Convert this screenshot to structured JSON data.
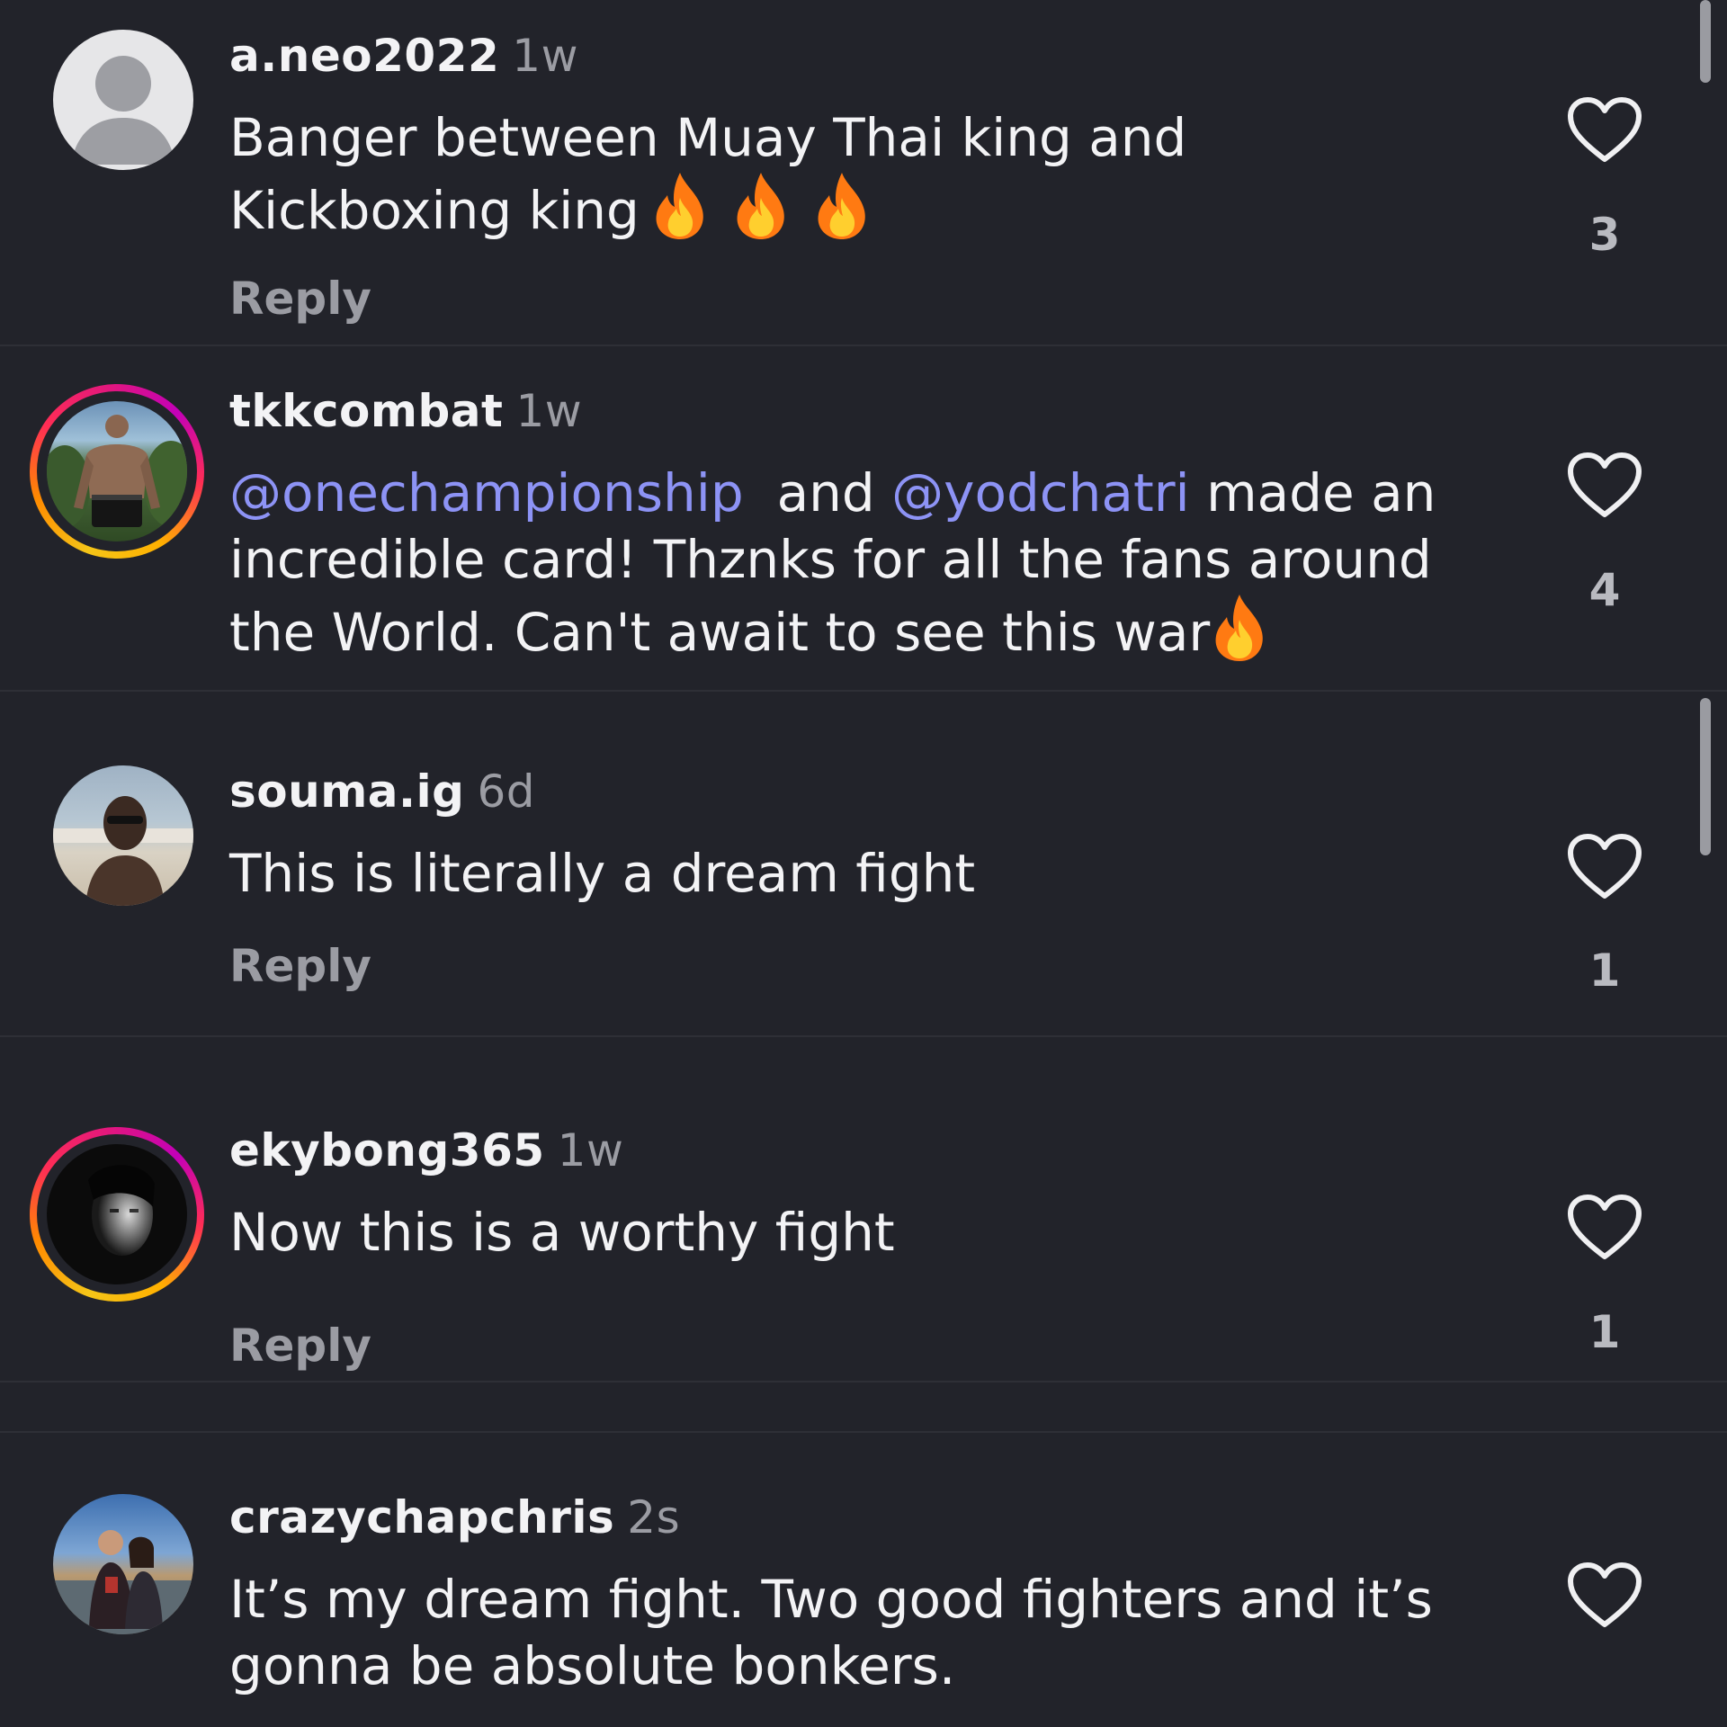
{
  "comments": [
    {
      "username": "a.neo2022",
      "time": "1w",
      "text": "Banger between Muay Thai king and Kickboxing king",
      "reply_label": "Reply",
      "likes": "3",
      "avatar": "default-user-avatar"
    },
    {
      "username": "tkkcombat",
      "time": "1w",
      "mention1": "@onechampionship",
      "text_mid": "and",
      "mention2": "@yodchatri",
      "text_rest": "made an incredible card! Thznks for all the fans around the World. Can't await to see this war",
      "likes": "4",
      "avatar": "photo-avatar-with-story-ring"
    },
    {
      "username": "souma.ig",
      "time": "6d",
      "text": "This is literally a dream fight",
      "reply_label": "Reply",
      "likes": "1",
      "avatar": "photo-avatar"
    },
    {
      "username": "ekybong365",
      "time": "1w",
      "text": "Now this is a worthy fight",
      "reply_label": "Reply",
      "likes": "1",
      "avatar": "photo-avatar-with-story-ring"
    },
    {
      "username": "crazychapchris",
      "time": "2s",
      "text": "It’s my dream fight. Two good fighters and it’s gonna be absolute bonkers.",
      "avatar": "photo-avatar"
    }
  ],
  "icons": {
    "like": "heart-outline-icon",
    "emoji": "fire-emoji"
  },
  "colors": {
    "background": "#22232a",
    "mention": "#8d93f5",
    "secondary_text": "#9b9ca3"
  }
}
